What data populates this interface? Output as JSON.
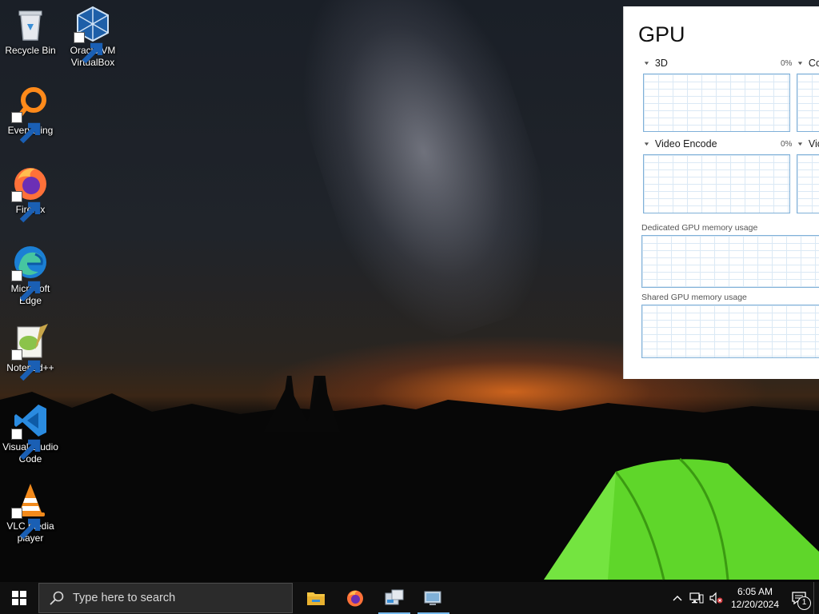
{
  "desktop": {
    "icons": [
      {
        "label": "Recycle Bin",
        "icon": "recycle-bin-icon"
      },
      {
        "label": "Oracle VM VirtualBox",
        "icon": "virtualbox-icon"
      },
      {
        "label": "Everything",
        "icon": "everything-search-icon"
      },
      {
        "label": "Firefox",
        "icon": "firefox-icon"
      },
      {
        "label": "Microsoft Edge",
        "icon": "edge-icon"
      },
      {
        "label": "Notepad++",
        "icon": "notepad-plus-plus-icon"
      },
      {
        "label": "Visual Studio Code",
        "icon": "vscode-icon"
      },
      {
        "label": "VLC media player",
        "icon": "vlc-icon"
      }
    ]
  },
  "gpu_panel": {
    "title": "GPU",
    "engines": [
      {
        "label": "3D",
        "percent": "0%"
      },
      {
        "label": "Co",
        "percent": ""
      },
      {
        "label": "Video Encode",
        "percent": "0%"
      },
      {
        "label": "Vic",
        "percent": ""
      }
    ],
    "dedicated_label": "Dedicated GPU memory usage",
    "shared_label": "Shared GPU memory usage"
  },
  "taskbar": {
    "search_placeholder": "Type here to search",
    "apps": [
      "file-explorer-icon",
      "firefox-icon",
      "virtualbox-manager-icon",
      "remote-desktop-icon"
    ],
    "clock_time": "6:05 AM",
    "clock_date": "12/20/2024",
    "notification_count": "1"
  },
  "colors": {
    "taskbar_bg": "#101010",
    "search_bg": "#2b2b2b",
    "graph_border": "#7fb0d8",
    "active_underline": "#76b9ed"
  }
}
